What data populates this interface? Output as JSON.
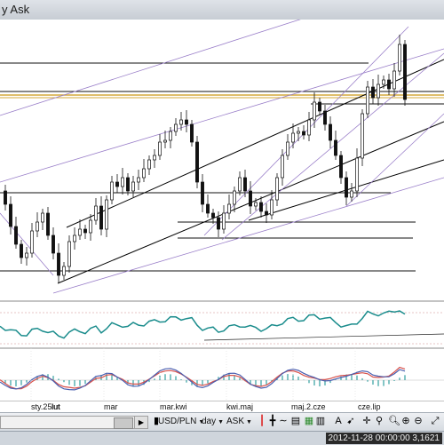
{
  "window": {
    "title": "y Ask"
  },
  "xaxis": {
    "labels": [
      "sty.25lut",
      "lut",
      "mar",
      "mar.kwi",
      "kwi.maj",
      "maj.2.cze",
      "cze.lip"
    ]
  },
  "toolbar": {
    "symbol": "USD/PLN",
    "period": "day",
    "price_type": "ASK"
  },
  "status": {
    "text": "2012-11-28 00:00:00  3,1621"
  },
  "colors": {
    "candle": "#111111",
    "trend": "#000000",
    "channel": "#9a7fc9",
    "resistance": "#d4a93a",
    "oscillator": "#1a8c8c",
    "macd_red": "#d8514a",
    "macd_blue": "#4a5fb0",
    "histogram": "#33a0a0"
  }
}
